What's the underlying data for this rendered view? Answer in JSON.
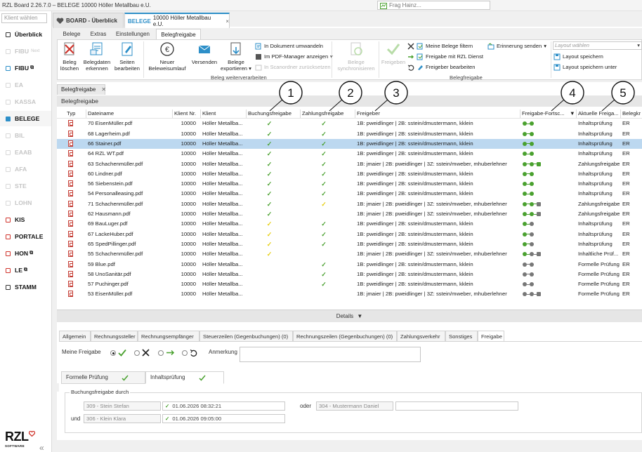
{
  "window": {
    "title": "RZL Board 2.26.7.0 – BELEGE 10000 Höller Metallbau e.U.",
    "search_placeholder": "Frag Hainz..."
  },
  "leftnav": {
    "client_placeholder": "Klient wählen",
    "items": [
      {
        "label": "Überblick",
        "color": "#333333",
        "dim": false
      },
      {
        "label": "FIBU",
        "suffix": "Next",
        "color": "#d8d8d8",
        "dim": true
      },
      {
        "label": "FIBU",
        "ext": "⧉",
        "color": "#2d8fc8",
        "dim": false
      },
      {
        "label": "EA",
        "color": "#d8d8d8",
        "dim": true
      },
      {
        "label": "KASSA",
        "color": "#d8d8d8",
        "dim": true
      },
      {
        "label": "BELEGE",
        "color": "#2d8fc8",
        "dim": false,
        "active": true
      },
      {
        "label": "BIL",
        "color": "#d8d8d8",
        "dim": true
      },
      {
        "label": "EAAB",
        "color": "#d8d8d8",
        "dim": true
      },
      {
        "label": "AFA",
        "color": "#d8d8d8",
        "dim": true
      },
      {
        "label": "STE",
        "color": "#d8d8d8",
        "dim": true
      },
      {
        "label": "LOHN",
        "color": "#d8d8d8",
        "dim": true
      },
      {
        "label": "KIS",
        "color": "#d0342c",
        "dim": false
      },
      {
        "label": "PORTALE",
        "color": "#d0342c",
        "dim": false
      },
      {
        "label": "HON",
        "ext": "⧉",
        "color": "#d0342c",
        "dim": false
      },
      {
        "label": "LE",
        "ext": "⧉",
        "color": "#d0342c",
        "dim": false
      },
      {
        "label": "STAMM",
        "color": "#333333",
        "dim": false
      }
    ],
    "logo": "RZL",
    "logo_sub": "SOFTWARE",
    "collapse": "«"
  },
  "doctabs": {
    "board": "BOARD - Überblick",
    "belege_kw": "BELEGE",
    "belege_label": "10000 Höller Metallbau e.U.",
    "close": "×"
  },
  "ribbon_tabs": [
    "Belege",
    "Extras",
    "Einstellungen",
    "Belegfreigabe"
  ],
  "ribbon": {
    "beleg_loeschen": "Beleg\nlöschen",
    "belegdaten_erkennen": "Belegdaten\nerkennen",
    "seiten_bearbeiten": "Seiten\nbearbeiten",
    "neuer_umlauf": "Neuer\nBeleweisumlauf",
    "versenden": "Versenden",
    "belege_exportieren": "Belege\nexportieren",
    "in_dokument": "In Dokument umwandeln",
    "in_pdf_manager": "Im PDF-Manager anzeigen",
    "in_scanordner": "In Scanordner zurücksetzen",
    "group_weiterverarbeiten": "Beleg weiterverarbeiten",
    "belege_sync": "Belege\nsynchronisieren",
    "freigeben": "Freigeben",
    "meine_belege": "Meine Belege filtern",
    "freigabe_rzl": "Freigabe mit RZL Dienst",
    "freigeber_bearbeiten": "Freigeber bearbeiten",
    "erinnerung": "Erinnerung senden",
    "group_belegfreigabe": "Belegfreigabe",
    "layout_placeholder": "Layout wählen",
    "layout_speichern": "Layout speichern",
    "layout_speichern_unter": "Layout speichern unter"
  },
  "content_tab": "Belegfreigabe",
  "section_title": "Belegfreigabe",
  "columns": [
    "Typ",
    "Dateiname",
    "Klient Nr.",
    "Klient",
    "Buchungsfreigabe",
    "Zahlungsfreigabe",
    "Freigeber",
    "Freigabe-Fortsc...",
    "Aktuelle Freiga...",
    "Belegkr"
  ],
  "callouts": [
    "1",
    "2",
    "3",
    "4",
    "5"
  ],
  "rows": [
    {
      "file": "70 EisenMüller.pdf",
      "nr": "10000",
      "klient": "Höller Metallba...",
      "bf": "g",
      "zf": "g",
      "freigeber": "1B: pweidlinger | 2B: sstein/dmustermann, kklein",
      "prog": "gg",
      "status": "Inhaltsprüfung",
      "bk": "ER"
    },
    {
      "file": "68 Lagerheim.pdf",
      "nr": "10000",
      "klient": "Höller Metallba...",
      "bf": "g",
      "zf": "g",
      "freigeber": "1B: pweidlinger | 2B: sstein/dmustermann, kklein",
      "prog": "gg",
      "status": "Inhaltsprüfung",
      "bk": "ER"
    },
    {
      "file": "66 Stainer.pdf",
      "nr": "10000",
      "klient": "Höller Metallba...",
      "bf": "g",
      "zf": "g",
      "freigeber": "1B: pweidlinger | 2B: sstein/dmustermann, kklein",
      "prog": "gg",
      "status": "Inhaltsprüfung",
      "bk": "ER",
      "selected": true
    },
    {
      "file": "64 RZL WT.pdf",
      "nr": "10000",
      "klient": "Höller Metallba...",
      "bf": "g",
      "zf": "g",
      "freigeber": "1B: pweidlinger | 2B: sstein/dmustermann, kklein",
      "prog": "gg",
      "status": "Inhaltsprüfung",
      "bk": "ER"
    },
    {
      "file": "63 Schachenmüller.pdf",
      "nr": "10000",
      "klient": "Höller Metallba...",
      "bf": "g",
      "zf": "g",
      "freigeber": "1B: jmaier | 2B: pweidlinger | 3Z: sstein/mweber, mhuberlehner",
      "prog": "ggs",
      "status": "Zahlungsfreigabe",
      "bk": "ER"
    },
    {
      "file": "60 Lindner.pdf",
      "nr": "10000",
      "klient": "Höller Metallba...",
      "bf": "g",
      "zf": "g",
      "freigeber": "1B: pweidlinger | 2B: sstein/dmustermann, kklein",
      "prog": "gg",
      "status": "Inhaltsprüfung",
      "bk": "ER"
    },
    {
      "file": "56 Siebenstein.pdf",
      "nr": "10000",
      "klient": "Höller Metallba...",
      "bf": "g",
      "zf": "g",
      "freigeber": "1B: pweidlinger | 2B: sstein/dmustermann, kklein",
      "prog": "gg",
      "status": "Inhaltsprüfung",
      "bk": "ER"
    },
    {
      "file": "54 Personalleasing.pdf",
      "nr": "10000",
      "klient": "Höller Metallba...",
      "bf": "g",
      "zf": "g",
      "freigeber": "1B: pweidlinger | 2B: sstein/dmustermann, kklein",
      "prog": "gg",
      "status": "Inhaltsprüfung",
      "bk": "ER"
    },
    {
      "file": "71 Schachenmüller.pdf",
      "nr": "10000",
      "klient": "Höller Metallba...",
      "bf": "g",
      "zf": "y",
      "freigeber": "1B: jmaier | 2B: pweidlinger | 3Z: sstein/mweber, mhuberlehner",
      "prog": "ggd",
      "status": "Zahlungsfreigabe",
      "bk": "ER"
    },
    {
      "file": "62 Hausmann.pdf",
      "nr": "10000",
      "klient": "Höller Metallba...",
      "bf": "g",
      "zf": "",
      "freigeber": "1B: jmaier | 2B: pweidlinger | 3Z: sstein/mweber, mhuberlehner",
      "prog": "ggd",
      "status": "Zahlungsfreigabe",
      "bk": "ER"
    },
    {
      "file": "69 BauLuger.pdf",
      "nr": "10000",
      "klient": "Höller Metallba...",
      "bf": "y",
      "zf": "g",
      "freigeber": "1B: pweidlinger | 2B: sstein/dmustermann, kklein",
      "prog": "gd",
      "status": "Inhaltsprüfung",
      "bk": "ER"
    },
    {
      "file": "67 LackeHuber.pdf",
      "nr": "10000",
      "klient": "Höller Metallba...",
      "bf": "y",
      "zf": "g",
      "freigeber": "1B: pweidlinger | 2B: sstein/dmustermann, kklein",
      "prog": "gd",
      "status": "Inhaltsprüfung",
      "bk": "ER"
    },
    {
      "file": "65 SpedPillinger.pdf",
      "nr": "10000",
      "klient": "Höller Metallba...",
      "bf": "y",
      "zf": "g",
      "freigeber": "1B: pweidlinger | 2B: sstein/dmustermann, kklein",
      "prog": "gd",
      "status": "Inhaltsprüfung",
      "bk": "ER"
    },
    {
      "file": "55 Schachenmüller.pdf",
      "nr": "10000",
      "klient": "Höller Metallba...",
      "bf": "y",
      "zf": "",
      "freigeber": "1B: jmaier | 2B: pweidlinger | 3Z: sstein/mweber, mhuberlehner",
      "prog": "gdd",
      "status": "Inhaltliche Prüf...",
      "bk": "ER"
    },
    {
      "file": "59 Blue.pdf",
      "nr": "10000",
      "klient": "Höller Metallba...",
      "bf": "",
      "zf": "g",
      "freigeber": "1B: pweidlinger | 2B: sstein/dmustermann, kklein",
      "prog": "dd",
      "status": "Formelle Prüfung",
      "bk": "ER"
    },
    {
      "file": "58 UnoSanitär.pdf",
      "nr": "10000",
      "klient": "Höller Metallba...",
      "bf": "",
      "zf": "g",
      "freigeber": "1B: pweidlinger | 2B: sstein/dmustermann, kklein",
      "prog": "dd",
      "status": "Formelle Prüfung",
      "bk": "ER"
    },
    {
      "file": "57 Puchinger.pdf",
      "nr": "10000",
      "klient": "Höller Metallba...",
      "bf": "",
      "zf": "g",
      "freigeber": "1B: pweidlinger | 2B: sstein/dmustermann, kklein",
      "prog": "dd",
      "status": "Formelle Prüfung",
      "bk": "ER"
    },
    {
      "file": "53 EisenMüller.pdf",
      "nr": "10000",
      "klient": "Höller Metallba...",
      "bf": "",
      "zf": "",
      "freigeber": "1B: jmaier | 2B: pweidlinger | 3Z: sstein/mweber, mhuberlehner",
      "prog": "ddd",
      "status": "Formelle Prüfung",
      "bk": "ER"
    }
  ],
  "details_label": "Details",
  "detail_tabs": [
    "Allgemein",
    "Rechnungssteller",
    "Rechnungsempfänger",
    "Steuerzeilen (Gegenbuchungen) (0)",
    "Rechnungszeilen (Gegenbuchungen) (0)",
    "Zahlungsverkehr",
    "Sonstiges",
    "Freigabe"
  ],
  "freigabe": {
    "meine_freigabe": "Meine Freigabe",
    "anmerkung": "Anmerkung",
    "subtabs": [
      "Formelle Prüfung",
      "Inhaltsprüfung"
    ],
    "buchungsfreigabe_durch": "Buchungsfreigabe durch",
    "person1": "309 - Stein Stefan",
    "date1": "01.06.2026 08:32:21",
    "oder": "oder",
    "person_alt": "304 - Mustermann Daniel",
    "und": "und",
    "person2": "306 - Klein Klara",
    "date2": "01.06.2026 09:05:00"
  },
  "colors": {
    "accent": "#2d8fc8",
    "green": "#4aa12f",
    "yellow": "#e6cf12",
    "selected": "#bcd8f0",
    "gray": "#777777"
  }
}
